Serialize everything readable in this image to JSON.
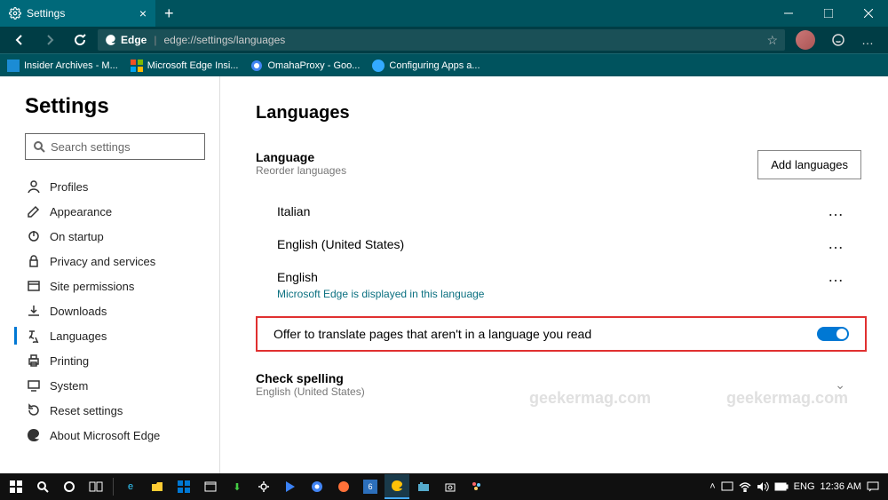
{
  "titlebar": {
    "tab_title": "Settings"
  },
  "address": {
    "engine": "Edge",
    "url": "edge://settings/languages"
  },
  "bookmarks": [
    "Insider Archives - M...",
    "Microsoft Edge Insi...",
    "OmahaProxy - Goo...",
    "Configuring Apps a..."
  ],
  "sidebar": {
    "title": "Settings",
    "search_placeholder": "Search settings",
    "items": [
      {
        "label": "Profiles"
      },
      {
        "label": "Appearance"
      },
      {
        "label": "On startup"
      },
      {
        "label": "Privacy and services"
      },
      {
        "label": "Site permissions"
      },
      {
        "label": "Downloads"
      },
      {
        "label": "Languages"
      },
      {
        "label": "Printing"
      },
      {
        "label": "System"
      },
      {
        "label": "Reset settings"
      },
      {
        "label": "About Microsoft Edge"
      }
    ]
  },
  "main": {
    "title": "Languages",
    "language_section": {
      "heading": "Language",
      "sub": "Reorder languages",
      "add_btn": "Add languages"
    },
    "languages": [
      {
        "name": "Italian"
      },
      {
        "name": "English (United States)"
      },
      {
        "name": "English",
        "note": "Microsoft Edge is displayed in this language"
      }
    ],
    "translate_row": "Offer to translate pages that aren't in a language you read",
    "spell": {
      "heading": "Check spelling",
      "sub": "English (United States)"
    }
  },
  "watermark": "geekermag.com",
  "tray": {
    "lang": "ENG",
    "time": "12:36 AM"
  }
}
